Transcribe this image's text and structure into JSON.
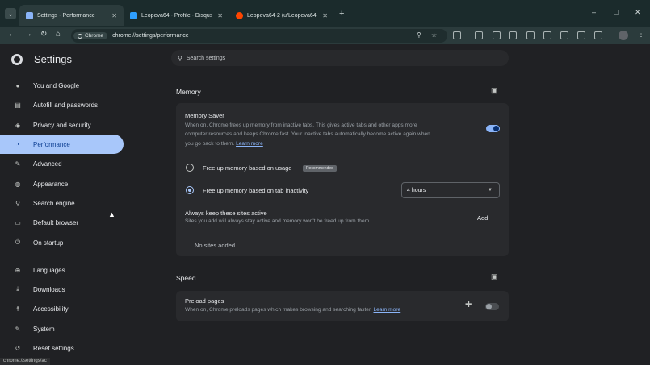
{
  "browser": {
    "tabs": [
      {
        "title": "Settings - Performance",
        "favicon": "gear-icon",
        "favicon_color": "#8ab4f8",
        "active": true
      },
      {
        "title": "Leopeva64 - Profile - Disqus",
        "favicon": "disqus-icon",
        "favicon_color": "#2e9fff",
        "active": false
      },
      {
        "title": "Leopeva64-2 (u/Leopeva64-2)",
        "favicon": "reddit-icon",
        "favicon_color": "#ff4500",
        "active": false
      }
    ],
    "new_tab": "+",
    "window_controls": {
      "minimize": "–",
      "maximize": "□",
      "close": "✕"
    },
    "omnibox": {
      "chip_label": "Chrome",
      "url": "chrome://settings/performance"
    }
  },
  "settings": {
    "title": "Settings",
    "search_placeholder": "Search settings",
    "sidebar": [
      {
        "label": "You and Google",
        "icon": "person-icon"
      },
      {
        "label": "Autofill and passwords",
        "icon": "clipboard-icon"
      },
      {
        "label": "Privacy and security",
        "icon": "shield-icon"
      },
      {
        "label": "Performance",
        "icon": "speedometer-icon",
        "active": true
      },
      {
        "label": "Advanced",
        "icon": "wrench-icon"
      },
      {
        "label": "Appearance",
        "icon": "palette-icon"
      },
      {
        "label": "Search engine",
        "icon": "search-icon"
      },
      {
        "label": "Default browser",
        "icon": "browser-icon"
      },
      {
        "label": "On startup",
        "icon": "power-icon"
      },
      {
        "label": "Languages",
        "icon": "globe-icon"
      },
      {
        "label": "Downloads",
        "icon": "download-icon"
      },
      {
        "label": "Accessibility",
        "icon": "accessibility-icon"
      },
      {
        "label": "System",
        "icon": "wrench-icon"
      },
      {
        "label": "Reset settings",
        "icon": "reset-icon"
      }
    ],
    "memory": {
      "section_title": "Memory",
      "saver_title": "Memory Saver",
      "saver_desc_1": "When on, Chrome frees up memory from inactive tabs. This gives active tabs and other apps more",
      "saver_desc_2": "computer resources and keeps Chrome fast. Your inactive tabs automatically become active again when",
      "saver_desc_3": "you go back to them.",
      "learn_more": "Learn more",
      "saver_enabled": true,
      "option_usage": "Free up memory based on usage",
      "option_usage_badge": "Recommended",
      "option_inactivity": "Free up memory based on tab inactivity",
      "inactivity_value": "4 hours",
      "keep_active_title": "Always keep these sites active",
      "keep_active_desc": "Sites you add will always stay active and memory won't be freed up from them",
      "add_label": "Add",
      "no_sites": "No sites added"
    },
    "speed": {
      "section_title": "Speed",
      "preload_title": "Preload pages",
      "preload_desc": "When on, Chrome preloads pages which makes browsing and searching faster.",
      "learn_more": "Learn more",
      "preload_enabled": false
    },
    "status_bar_url": "chrome://settings/ac"
  }
}
